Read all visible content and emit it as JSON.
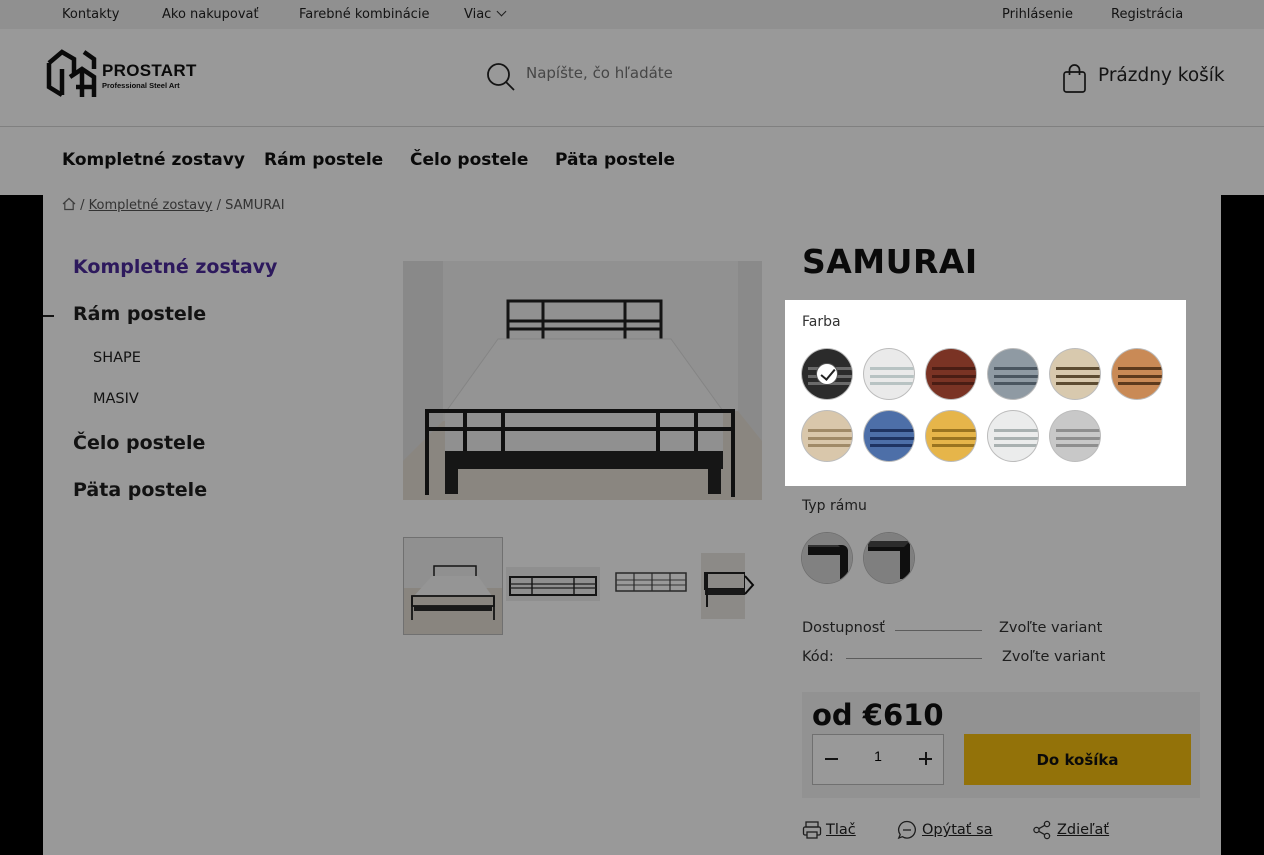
{
  "topbar": {
    "links": [
      "Kontakty",
      "Ako nakupovať",
      "Farebné kombinácie",
      "Viac"
    ],
    "login": "Prihlásenie",
    "register": "Registrácia"
  },
  "header": {
    "logo_name": "PROSTART",
    "logo_sub": "Professional Steel Art",
    "search_placeholder": "Napíšte, čo hľadáte",
    "cart_label": "Prázdny košík"
  },
  "nav": [
    "Kompletné zostavy",
    "Rám postele",
    "Čelo postele",
    "Päta postele"
  ],
  "breadcrumb": {
    "sep": "/",
    "category": "Kompletné zostavy",
    "current": "SAMURAI"
  },
  "sidebar": [
    {
      "label": "Kompletné zostavy",
      "level": 1,
      "active": true
    },
    {
      "label": "Rám postele",
      "level": 1,
      "active": false
    },
    {
      "label": "SHAPE",
      "level": 2,
      "active": false
    },
    {
      "label": "MASIV",
      "level": 2,
      "active": false
    },
    {
      "label": "Čelo postele",
      "level": 1,
      "active": false
    },
    {
      "label": "Päta postele",
      "level": 1,
      "active": false
    }
  ],
  "product": {
    "title": "SAMURAI",
    "color_label": "Farba",
    "colors": [
      {
        "bg": "#2b2b2b",
        "stripe": "#6a6a6a",
        "selected": true
      },
      {
        "bg": "#eaeaea",
        "stripe": "#b8c3c3",
        "selected": false
      },
      {
        "bg": "#7a3324",
        "stripe": "#4a1d14",
        "selected": false
      },
      {
        "bg": "#8f9aa3",
        "stripe": "#4b5660",
        "selected": false
      },
      {
        "bg": "#d8c9ae",
        "stripe": "#5d4c32",
        "selected": false
      },
      {
        "bg": "#c98a56",
        "stripe": "#5c3a1d",
        "selected": false
      },
      {
        "bg": "#d9c7ab",
        "stripe": "#a08a68",
        "selected": false
      },
      {
        "bg": "#4d6fa8",
        "stripe": "#1f3462",
        "selected": false
      },
      {
        "bg": "#e6b54a",
        "stripe": "#9a7420",
        "selected": false
      },
      {
        "bg": "#ebecec",
        "stripe": "#a9b1b1",
        "selected": false
      },
      {
        "bg": "#c8c8c8",
        "stripe": "#8e8e8e",
        "selected": false
      }
    ],
    "frame_label": "Typ rámu",
    "availability_label": "Dostupnosť",
    "availability_value": "Zvoľte variant",
    "code_label": "Kód:",
    "code_value": "Zvoľte variant",
    "price": "od €610",
    "qty": "1",
    "add_to_cart": "Do košíka"
  },
  "actions": {
    "print": "Tlač",
    "ask": "Opýtať sa",
    "share": "Zdieľať"
  }
}
